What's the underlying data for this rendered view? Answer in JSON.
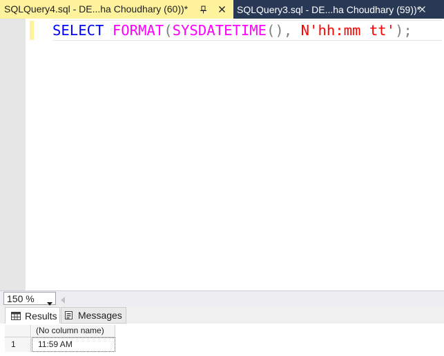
{
  "tabs": [
    {
      "title": "SQLQuery4.sql - DE...ha Choudhary (60))*",
      "active": true
    },
    {
      "title": "SQLQuery3.sql - DE...ha Choudhary (59))*",
      "active": false
    }
  ],
  "editor": {
    "query": {
      "select": "SELECT",
      "format_fn": "FORMAT",
      "open_paren": "(",
      "sysdatetime_fn": "SYSDATETIME",
      "empty_parens": "()",
      "comma": ",",
      "string_literal": "N'hh:mm tt'",
      "close": ");"
    }
  },
  "zoom": {
    "value": "150 %"
  },
  "results": {
    "tabs": {
      "results": "Results",
      "messages": "Messages"
    },
    "column_header": "(No column name)",
    "rows": [
      {
        "row_number": "1",
        "value": "11:59 AM"
      }
    ]
  },
  "colors": {
    "tab_active_bg": "#fff29d",
    "tab_strip_bg": "#293955",
    "keyword": "#0000ff",
    "function": "#ff00ff",
    "string": "#ff0000"
  },
  "icons": {
    "pin": "pin-icon",
    "close": "close-icon",
    "results_tab": "grid-icon",
    "messages_tab": "messages-icon",
    "zoom_dropdown": "chevron-down-icon",
    "scroll_left": "scroll-left-icon"
  }
}
